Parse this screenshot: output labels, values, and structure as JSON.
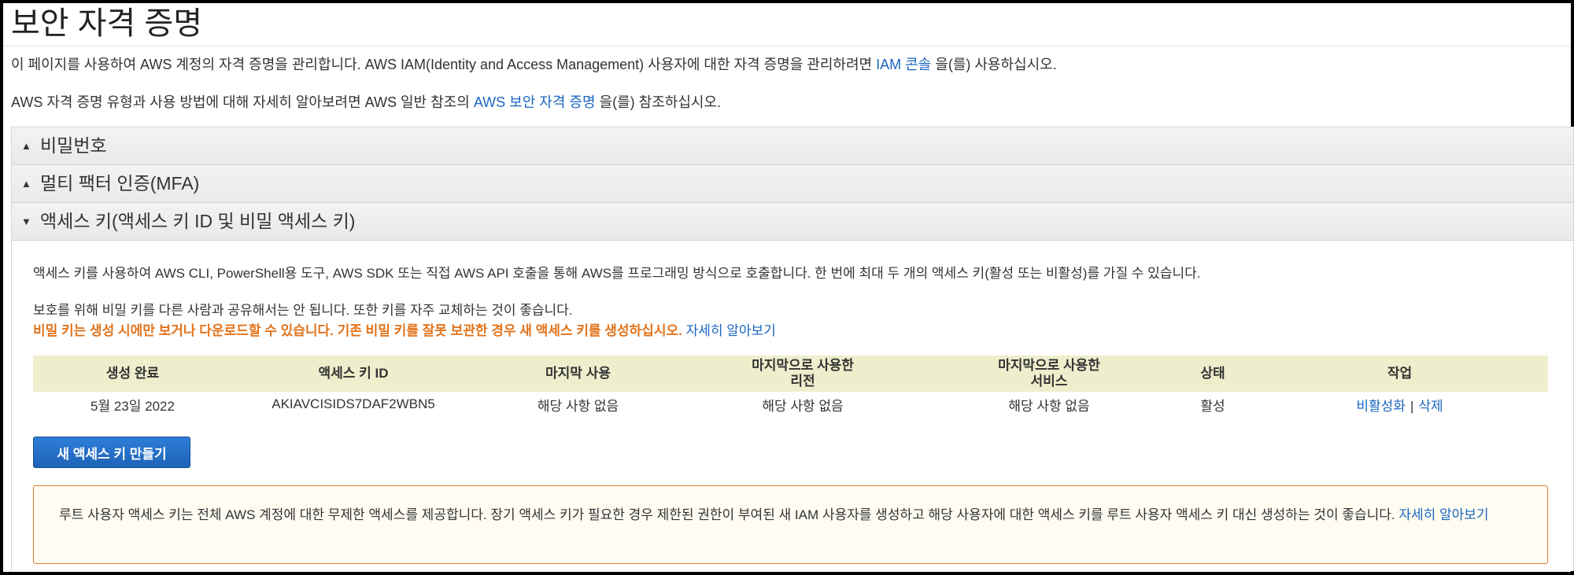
{
  "page": {
    "title": "보안 자격 증명",
    "intro1_prefix": "이 페이지를 사용하여 AWS 계정의 자격 증명을 관리합니다. AWS IAM(Identity and Access Management) 사용자에 대한 자격 증명을 관리하려면",
    "intro1_link": "IAM 콘솔",
    "intro1_suffix": "을(를) 사용하십시오.",
    "intro2_prefix": "AWS 자격 증명 유형과 사용 방법에 대해 자세히 알아보려면 AWS 일반 참조의",
    "intro2_link": "AWS 보안 자격 증명",
    "intro2_suffix": "을(를) 참조하십시오."
  },
  "sections": {
    "password": {
      "label": "비밀번호",
      "icon": "triangle-up-icon"
    },
    "mfa": {
      "label": "멀티 팩터 인증(MFA)",
      "icon": "triangle-up-icon"
    },
    "access_keys": {
      "label": "액세스 키(액세스 키 ID 및 비밀 액세스 키)",
      "icon": "triangle-down-icon"
    }
  },
  "access_keys": {
    "desc1": "액세스 키를 사용하여 AWS CLI, PowerShell용 도구, AWS SDK 또는 직접 AWS API 호출을 통해 AWS를 프로그래밍 방식으로 호출합니다. 한 번에 최대 두 개의 액세스 키(활성 또는 비활성)를 가질 수 있습니다.",
    "desc2": "보호를 위해 비밀 키를 다른 사람과 공유해서는 안 됩니다. 또한 키를 자주 교체하는 것이 좋습니다.",
    "warning_text": "비밀 키는 생성 시에만 보거나 다운로드할 수 있습니다. 기존 비밀 키를 잘못 보관한 경우 새 액세스 키를 생성하십시오.",
    "learn_more": "자세히 알아보기",
    "columns": {
      "created": "생성 완료",
      "key_id": "액세스 키 ID",
      "last_used": "마지막 사용",
      "last_region_1": "마지막으로 사용한",
      "last_region_2": "리전",
      "last_service_1": "마지막으로 사용한",
      "last_service_2": "서비스",
      "status": "상태",
      "actions": "작업"
    },
    "rows": [
      {
        "created": "5월 23일 2022",
        "key_id": "AKIAVCISIDS7DAF2WBN5",
        "last_used": "해당 사항 없음",
        "last_region": "해당 사항 없음",
        "last_service": "해당 사항 없음",
        "status": "활성",
        "deactivate": "비활성화",
        "separator": "|",
        "delete": "삭제"
      }
    ],
    "create_button": "새 액세스 키 만들기",
    "root_warning": "루트 사용자 액세스 키는 전체 AWS 계정에 대한 무제한 액세스를 제공합니다. 장기 액세스 키가 필요한 경우 제한된 권한이 부여된 새 IAM 사용자를 생성하고 해당 사용자에 대한 액세스 키를 루트 사용자 액세스 키 대신 생성하는 것이 좋습니다.",
    "root_learn_more": "자세히 알아보기"
  },
  "colors": {
    "link": "#1a66c0",
    "warning_orange": "#e2741d",
    "table_header_bg": "#eeeecd",
    "button_blue": "#1d63b8"
  }
}
